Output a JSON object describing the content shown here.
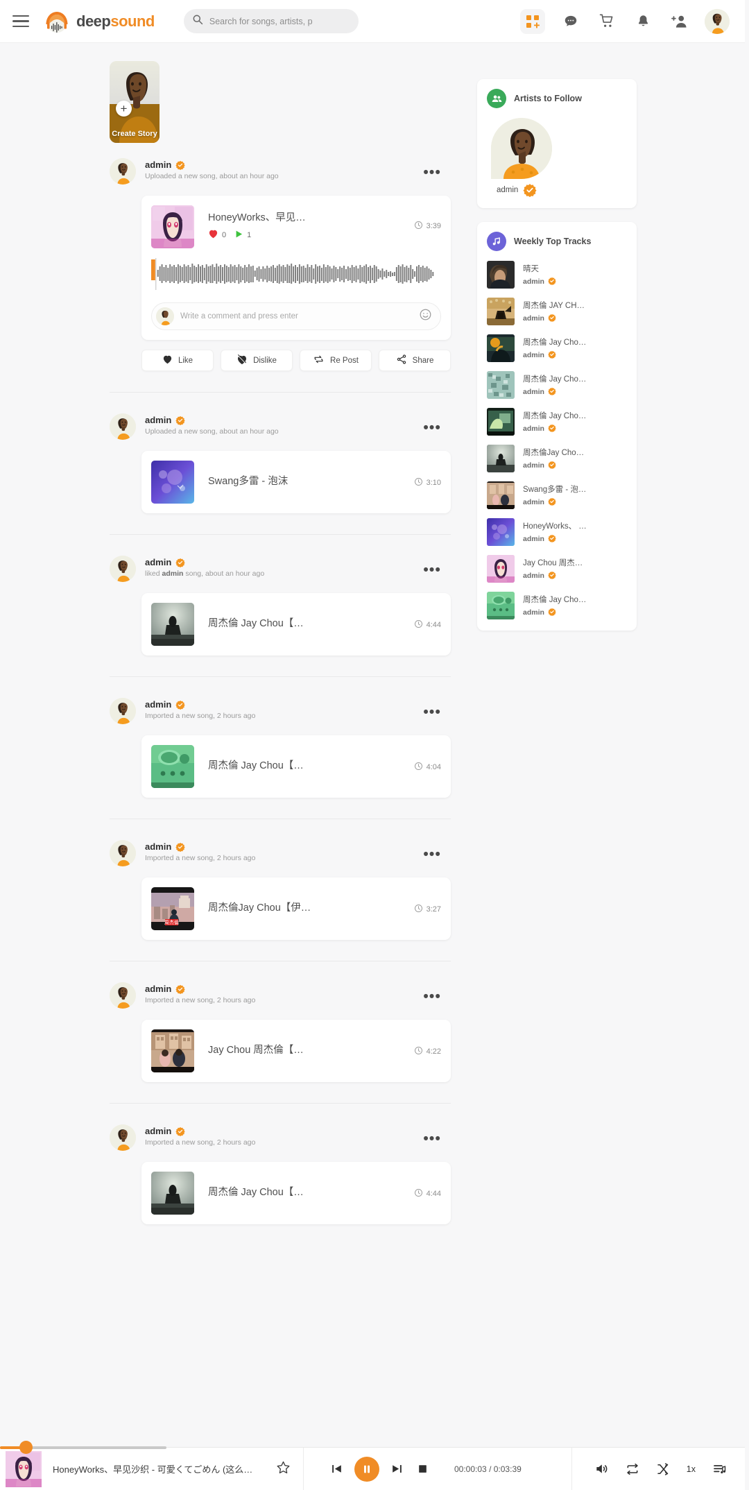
{
  "header": {
    "menu_icon": "hamburger-menu-icon",
    "brand": {
      "first": "deep",
      "second": "sound"
    },
    "search": {
      "placeholder": "Search for songs, artists, p",
      "value": ""
    },
    "icons": [
      {
        "name": "apps-grid-icon",
        "label": "Apps"
      },
      {
        "name": "messages-icon",
        "label": "Messages"
      },
      {
        "name": "cart-icon",
        "label": "Cart"
      },
      {
        "name": "notifications-bell-icon",
        "label": "Notifications"
      },
      {
        "name": "add-friend-icon",
        "label": "Friend Requests"
      }
    ],
    "avatar_alt": "admin"
  },
  "story": {
    "label": "Create Story",
    "plus": "+"
  },
  "feed": [
    {
      "user": "admin",
      "verified": true,
      "action_prefix": "Uploaded a new song, about an hour ago",
      "action_bold": "",
      "action_suffix": "",
      "song": {
        "title": "HoneyWorks、早见…",
        "duration": "3:39",
        "likes": "0",
        "plays": "1"
      },
      "expanded": true,
      "comment_placeholder": "Write a comment and press enter",
      "buttons": [
        {
          "name": "like-button",
          "label": "Like"
        },
        {
          "name": "dislike-button",
          "label": "Dislike"
        },
        {
          "name": "repost-button",
          "label": "Re Post"
        },
        {
          "name": "share-button",
          "label": "Share"
        }
      ]
    },
    {
      "user": "admin",
      "verified": true,
      "action_prefix": "Uploaded a new song, about an hour ago",
      "song": {
        "title": "Swang多雷 - 泡沫",
        "duration": "3:10"
      },
      "expanded": false
    },
    {
      "user": "admin",
      "verified": true,
      "action_prefix": "liked ",
      "action_bold": "admin",
      "action_suffix": " song, about an hour ago",
      "song": {
        "title": "周杰倫 Jay Chou【…",
        "duration": "4:44"
      },
      "expanded": false
    },
    {
      "user": "admin",
      "verified": true,
      "action_prefix": "Imported a new song, 2 hours ago",
      "song": {
        "title": "周杰倫 Jay Chou【…",
        "duration": "4:04"
      },
      "expanded": false
    },
    {
      "user": "admin",
      "verified": true,
      "action_prefix": "Imported a new song, 2 hours ago",
      "song": {
        "title": "周杰倫Jay Chou【伊…",
        "duration": "3:27"
      },
      "expanded": false
    },
    {
      "user": "admin",
      "verified": true,
      "action_prefix": "Imported a new song, 2 hours ago",
      "song": {
        "title": "Jay Chou 周杰倫【…",
        "duration": "4:22"
      },
      "expanded": false
    },
    {
      "user": "admin",
      "verified": true,
      "action_prefix": "Imported a new song, 2 hours ago",
      "song": {
        "title": "周杰倫 Jay Chou【…",
        "duration": "4:44"
      },
      "expanded": false
    }
  ],
  "artists_widget": {
    "title": "Artists to Follow",
    "icon": "group-people-icon",
    "badge_color": "#3aaa5a",
    "artists": [
      {
        "name": "admin",
        "verified": true
      }
    ]
  },
  "tracks_widget": {
    "title": "Weekly Top Tracks",
    "icon": "music-note-icon",
    "badge_color": "#6c63d8",
    "tracks": [
      {
        "title": "晴天",
        "by": "admin",
        "verified": true
      },
      {
        "title": "周杰倫 JAY CH…",
        "by": "admin",
        "verified": true
      },
      {
        "title": "周杰倫 Jay Cho…",
        "by": "admin",
        "verified": true
      },
      {
        "title": "周杰倫 Jay Cho…",
        "by": "admin",
        "verified": true
      },
      {
        "title": "周杰倫 Jay Cho…",
        "by": "admin",
        "verified": true
      },
      {
        "title": "周杰倫Jay Cho…",
        "by": "admin",
        "verified": true
      },
      {
        "title": "Swang多雷 - 泡…",
        "by": "admin",
        "verified": true
      },
      {
        "title": "HoneyWorks、 …",
        "by": "admin",
        "verified": true
      },
      {
        "title": "Jay Chou 周杰…",
        "by": "admin",
        "verified": true
      },
      {
        "title": "周杰倫 Jay Cho…",
        "by": "admin",
        "verified": true
      }
    ]
  },
  "player": {
    "title": "HoneyWorks、早见沙织 - 可愛くてごめん (这么…",
    "current_time": "00:00:03",
    "separator": "/",
    "total_time": "0:03:39",
    "speed": "1x",
    "state": "playing",
    "progress_percent": 1.5,
    "controls": [
      {
        "name": "previous-track-button"
      },
      {
        "name": "play-pause-button"
      },
      {
        "name": "next-track-button"
      },
      {
        "name": "stop-button"
      }
    ],
    "right_controls": [
      {
        "name": "volume-button"
      },
      {
        "name": "repeat-button"
      },
      {
        "name": "shuffle-button"
      },
      {
        "name": "playback-speed-button"
      },
      {
        "name": "queue-playlist-button"
      }
    ]
  },
  "colors": {
    "accent": "#f08c26",
    "verified": "#f3951f",
    "like_heart": "#e8333a",
    "play_green": "#3ec23e",
    "page_bg": "#f7f7f8",
    "card_bg": "#ffffff"
  }
}
